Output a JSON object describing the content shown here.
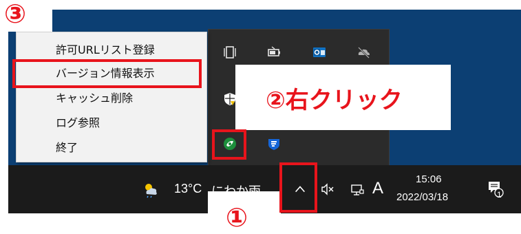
{
  "context_menu": {
    "items": [
      {
        "label": "許可URLリスト登録"
      },
      {
        "label": "バージョン情報表示"
      },
      {
        "label": "キャッシュ削除"
      },
      {
        "label": "ログ参照"
      },
      {
        "label": "終了"
      }
    ]
  },
  "annotations": {
    "step3": "③",
    "step2": "②右クリック",
    "step1": "①"
  },
  "taskbar": {
    "weather_temp": "13°C",
    "weather_text": "にわか雨",
    "ime": "A",
    "time": "15:06",
    "date": "2022/03/18",
    "notification_count": "1"
  },
  "tray_icons": [
    "tablet-mode-icon",
    "battery-icon",
    "outlook-icon",
    "onedrive-offline-icon",
    "defender-security-icon",
    "green-app-icon",
    "blue-shield-app-icon"
  ],
  "colors": {
    "annotation_red": "#e8141c",
    "desktop_blue": "#0c3f73",
    "taskbar": "#1b1b1b",
    "flyout": "#2b2b2b",
    "menu_bg": "#f2f2f2"
  }
}
